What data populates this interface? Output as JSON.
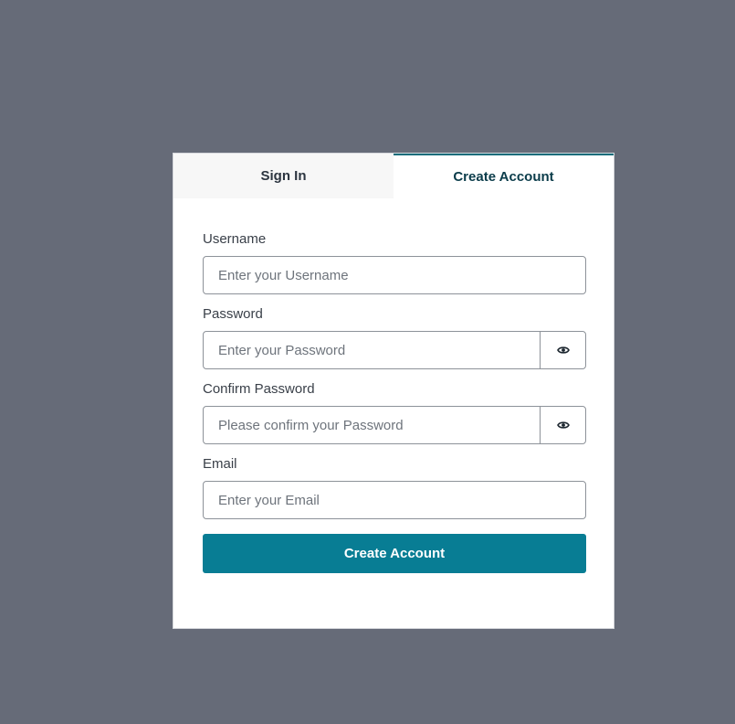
{
  "tabs": {
    "sign_in": "Sign In",
    "create_account": "Create Account",
    "active": "create_account"
  },
  "form": {
    "username": {
      "label": "Username",
      "placeholder": "Enter your Username",
      "value": ""
    },
    "password": {
      "label": "Password",
      "placeholder": "Enter your Password",
      "value": ""
    },
    "confirm_password": {
      "label": "Confirm Password",
      "placeholder": "Please confirm your Password",
      "value": ""
    },
    "email": {
      "label": "Email",
      "placeholder": "Enter your Email",
      "value": ""
    },
    "submit_label": "Create Account"
  },
  "icons": {
    "password_toggle": "eye-icon",
    "confirm_password_toggle": "eye-icon"
  },
  "colors": {
    "backdrop": "#666b78",
    "accent": "#087d94",
    "active_tab_text": "#0b3c4a"
  }
}
